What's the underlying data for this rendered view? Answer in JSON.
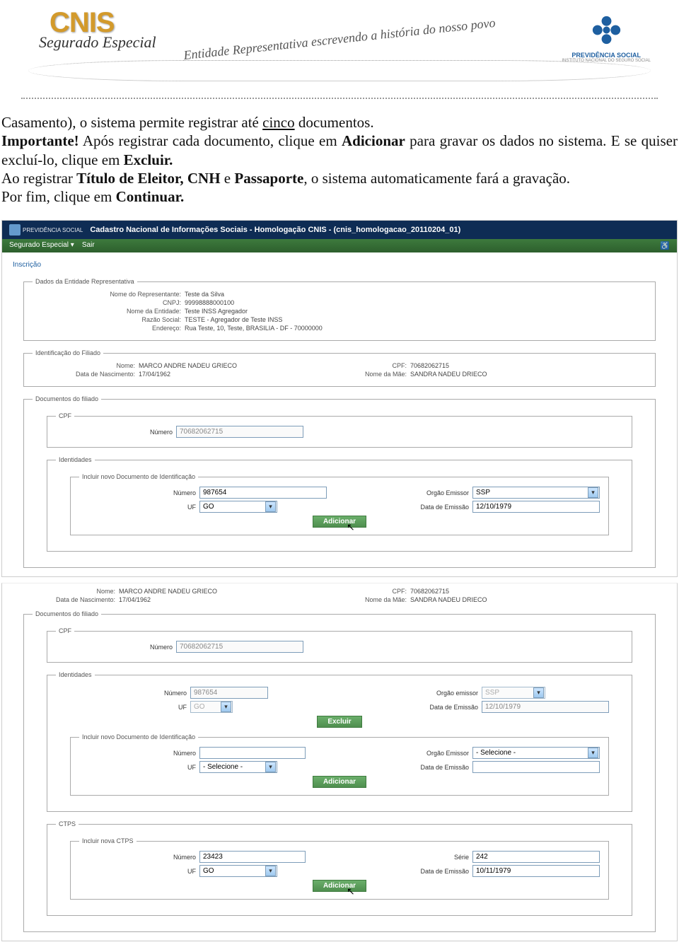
{
  "header": {
    "logo_main": "CNIS",
    "logo_sub": "Segurado Especial",
    "tagline": "Entidade Representativa escrevendo a história do nosso povo",
    "prev_text": "PREVIDÊNCIA SOCIAL",
    "prev_sub": "INSTITUTO NACIONAL DO SEGURO SOCIAL"
  },
  "body": {
    "p1_a": "Casamento), o sistema permite registrar até ",
    "p1_u": "cinco",
    "p1_b": " documentos.",
    "p2_a": "Importante!",
    "p2_b": " Após registrar cada documento, clique em ",
    "p2_c": "Adicionar",
    "p2_d": " para gravar os dados no sistema. E se quiser excluí-lo, clique em ",
    "p2_e": "Excluir.",
    "p3_a": "Ao registrar ",
    "p3_b": "Título de Eleitor, CNH",
    "p3_c": " e ",
    "p3_d": "Passaporte",
    "p3_e": ", o sistema automaticamente fará a gravação.",
    "p4_a": "Por fim, clique em ",
    "p4_b": "Continuar."
  },
  "app": {
    "header_brand": "PREVIDÊNCIA SOCIAL",
    "header_title_pre": "CNIS",
    "header_title": "Cadastro Nacional de Informações Sociais - Homologação CNIS - (cnis_homologacao_20110204_01)",
    "menu1": "Segurado Especial ▾",
    "menu2": "Sair",
    "inscricao": "Inscrição",
    "fieldsets": {
      "entidade": {
        "legend": "Dados da Entidade Representativa",
        "nome_repr_label": "Nome do Representante:",
        "nome_repr": "Teste da Silva",
        "cnpj_label": "CNPJ:",
        "cnpj": "99998888000100",
        "nome_ent_label": "Nome da Entidade:",
        "nome_ent": "Teste INSS Agregador",
        "razao_label": "Razão Social:",
        "razao": "TESTE - Agregador de Teste INSS",
        "endereco_label": "Endereço:",
        "endereco": "Rua Teste, 10, Teste, BRASILIA - DF - 70000000"
      },
      "filiado": {
        "legend": "Identificação do Filiado",
        "nome_label": "Nome:",
        "nome": "MARCO ANDRE NADEU GRIECO",
        "cpf_label": "CPF:",
        "cpf": "70682062715",
        "data_nasc_label": "Data de Nascimento:",
        "data_nasc": "17/04/1962",
        "mae_label": "Nome da Mãe:",
        "mae": "SANDRA NADEU DRIECO"
      },
      "docs": {
        "legend": "Documentos do filiado",
        "cpf_legend": "CPF",
        "cpf_numero_label": "Número",
        "cpf_numero": "70682062715",
        "ident_legend": "Identidades",
        "novo_doc_legend": "Incluir novo Documento de Identificação",
        "numero_label": "Número",
        "numero": "987654",
        "orgao_label": "Orgão Emissor",
        "orgao_label_lc": "Orgão emissor",
        "orgao": "SSP",
        "uf_label": "UF",
        "uf": "GO",
        "data_em_label": "Data de Emissão",
        "data_em": "12/10/1979",
        "adicionar": "Adicionar",
        "excluir": "Excluir",
        "selecione": "- Selecione -"
      },
      "ctps": {
        "legend": "CTPS",
        "sub_legend": "Incluir nova CTPS",
        "numero": "23423",
        "serie_label": "Série",
        "serie": "242",
        "uf": "GO",
        "data_em": "10/11/1979"
      }
    }
  }
}
